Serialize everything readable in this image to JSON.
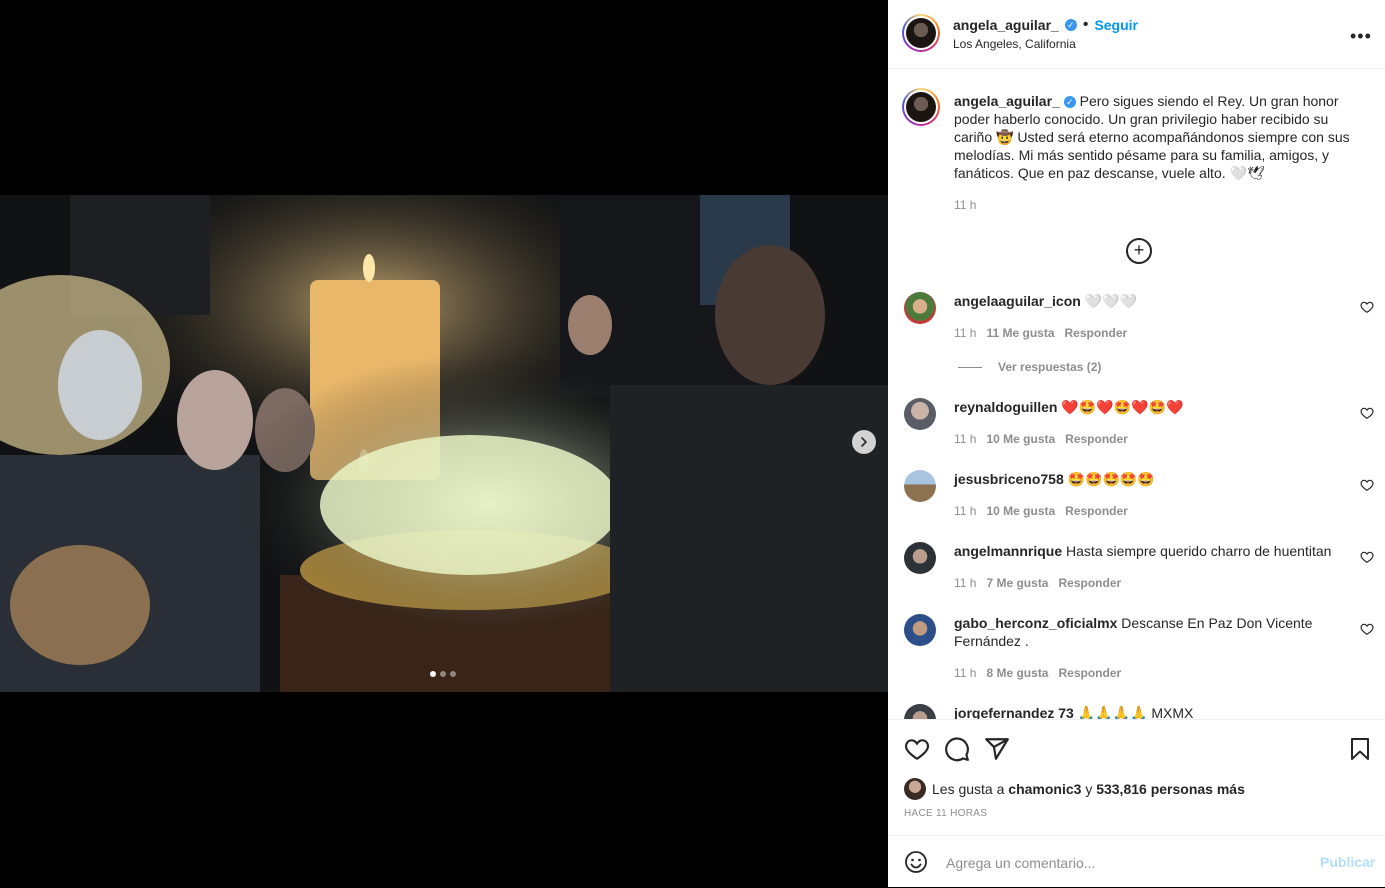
{
  "post": {
    "username": "angela_aguilar_",
    "follow_label": "Seguir",
    "location": "Los Angeles, California",
    "more_label": "•••",
    "carousel": {
      "current_slide": 1,
      "total_slides": 3
    }
  },
  "caption": {
    "username": "angela_aguilar_",
    "text": "Pero sigues siendo el Rey. Un gran honor poder haberlo conocido. Un gran privilegio haber recibido su cariño 🤠 Usted será eterno acompañándonos siempre con sus melodías. Mi más sentido pésame para su familia, amigos, y fanáticos. Que en paz descanse, vuele alto. 🤍🕊",
    "time": "11 h"
  },
  "comments": [
    {
      "user": "angelaaguilar_icon",
      "text": "🤍🤍🤍",
      "time": "11 h",
      "likes": "11 Me gusta",
      "reply": "Responder"
    },
    {
      "user": "reynaldoguillen",
      "text": "❤️🤩❤️🤩❤️🤩❤️",
      "time": "11 h",
      "likes": "10 Me gusta",
      "reply": "Responder"
    },
    {
      "user": "jesusbriceno758",
      "text": "🤩🤩🤩🤩🤩",
      "time": "11 h",
      "likes": "10 Me gusta",
      "reply": "Responder"
    },
    {
      "user": "angelmannrique",
      "text": "Hasta siempre querido charro de huentitan",
      "time": "11 h",
      "likes": "7 Me gusta",
      "reply": "Responder"
    },
    {
      "user": "gabo_herconz_oficialmx",
      "text": "Descanse En Paz Don Vicente Fernández .",
      "time": "11 h",
      "likes": "8 Me gusta",
      "reply": "Responder"
    },
    {
      "user": "jorgefernandez 73",
      "text": "🙏🙏🙏🙏 MXMX"
    }
  ],
  "view_replies": "Ver respuestas (2)",
  "likes_line": {
    "prefix": "Les gusta a",
    "user": "chamonic3",
    "middle": "y",
    "count": "533,816 personas más"
  },
  "posted_ago": "HACE 11 HORAS",
  "composer": {
    "placeholder": "Agrega un comentario...",
    "publish_label": "Publicar"
  },
  "colors": {
    "link": "#0095f6",
    "verified": "#3897f0",
    "publish_disabled": "#b2dffc"
  }
}
